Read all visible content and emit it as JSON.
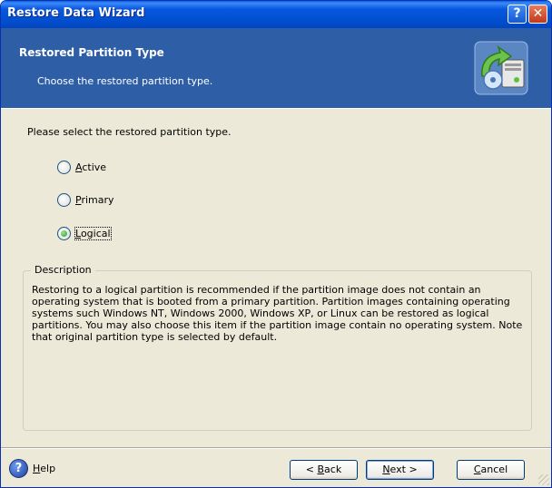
{
  "window": {
    "title": "Restore Data Wizard"
  },
  "titlebar": {
    "help_glyph": "?",
    "close_glyph": "✕"
  },
  "header": {
    "title": "Restored Partition Type",
    "subtitle": "Choose the restored partition type.",
    "icon": "restore-wizard-icon"
  },
  "main": {
    "prompt": "Please select the restored partition type.",
    "options": [
      {
        "label": "Active",
        "mnemonic": "A",
        "rest": "ctive",
        "selected": false
      },
      {
        "label": "Primary",
        "mnemonic": "P",
        "rest": "rimary",
        "selected": false
      },
      {
        "label": "Logical",
        "mnemonic": "L",
        "rest": "ogical",
        "selected": true
      }
    ],
    "description": {
      "legend": "Description",
      "text": "Restoring to a logical partition is recommended if the partition image does not contain an operating system that is booted from a primary partition. Partition images containing operating systems such Windows NT, Windows 2000, Windows XP, or Linux can be restored as logical partitions. You may also choose this item if the partition image contain no operating system. Note that original partition type is selected by default."
    }
  },
  "footer": {
    "help": {
      "mnemonic": "H",
      "rest": "elp"
    },
    "back": {
      "prefix": "< ",
      "mnemonic": "B",
      "rest": "ack"
    },
    "next": {
      "mnemonic": "N",
      "rest": "ext >"
    },
    "cancel": {
      "mnemonic": "C",
      "rest": "ancel"
    }
  },
  "colors": {
    "titlebar": "#0150d0",
    "header": "#2e5fa6",
    "face": "#ece9d8"
  }
}
